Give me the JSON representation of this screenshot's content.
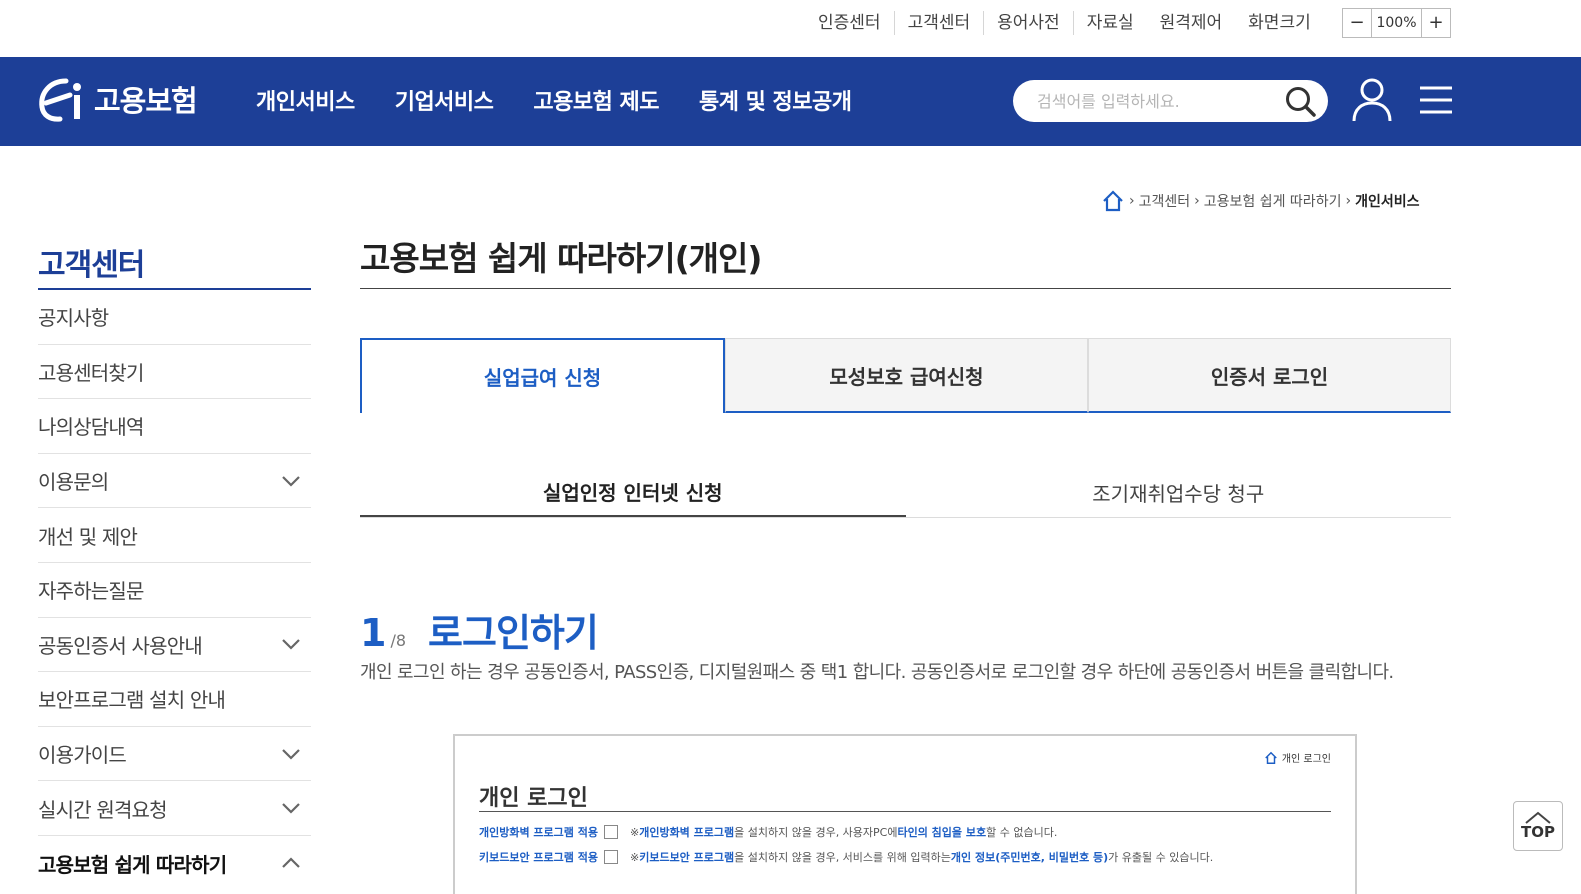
{
  "util": {
    "links": [
      "인증센터",
      "고객센터",
      "용어사전",
      "자료실",
      "원격제어",
      "화면크기"
    ],
    "zoom_minus": "−",
    "zoom_value": "100%",
    "zoom_plus": "+"
  },
  "header": {
    "logo_text": "고용보험",
    "menu": [
      "개인서비스",
      "기업서비스",
      "고용보험 제도",
      "통계 및 정보공개"
    ],
    "search_placeholder": "검색어를 입력하세요.",
    "icons": {
      "search": "search-icon",
      "user": "user-icon",
      "menu": "hamburger-icon"
    },
    "bg_color": "#1d3f97"
  },
  "breadcrumb": [
    "고객센터",
    "고용보험 쉽게 따라하기",
    "개인서비스"
  ],
  "sidebar": {
    "title": "고객센터",
    "items": [
      {
        "label": "공지사항",
        "expandable": false
      },
      {
        "label": "고용센터찾기",
        "expandable": false
      },
      {
        "label": "나의상담내역",
        "expandable": false
      },
      {
        "label": "이용문의",
        "expandable": true
      },
      {
        "label": "개선 및 제안",
        "expandable": false
      },
      {
        "label": "자주하는질문",
        "expandable": false
      },
      {
        "label": "공동인증서 사용안내",
        "expandable": true
      },
      {
        "label": "보안프로그램 설치 안내",
        "expandable": false
      },
      {
        "label": "이용가이드",
        "expandable": true
      },
      {
        "label": "실시간 원격요청",
        "expandable": true
      },
      {
        "label": "고용보험 쉽게 따라하기",
        "expandable": true,
        "expanded": true,
        "active": true
      }
    ]
  },
  "main": {
    "title": "고용보험 쉽게 따라하기(개인)",
    "tabs": [
      {
        "label": "실업급여 신청",
        "active": true
      },
      {
        "label": "모성보호 급여신청",
        "active": false
      },
      {
        "label": "인증서 로그인",
        "active": false
      }
    ],
    "subtabs": [
      {
        "label": "실업인정 인터넷 신청",
        "active": true
      },
      {
        "label": "조기재취업수당 청구",
        "active": false
      }
    ],
    "step": {
      "current": "1",
      "total": "/8",
      "title": "로그인하기",
      "description": "개인 로그인 하는 경우 공동인증서, PASS인증, 디지털원패스 중 택1 합니다. 공동인증서로 로그인할 경우 하단에 공동인증서 버튼을 클릭합니다."
    },
    "screenshot": {
      "breadcrumb": "개인 로그인",
      "title": "개인 로그인",
      "rows": [
        {
          "label": "개인방화벽 프로그램 적용",
          "note_prefix": "※ ",
          "note_hl1": "개인방화벽 프로그램",
          "note_mid": "을 설치하지 않을 경우, 사용자PC에 ",
          "note_hl2": "타인의 침입을 보호",
          "note_suffix": "할 수 없습니다."
        },
        {
          "label": "키보드보안 프로그램 적용",
          "note_prefix": "※ ",
          "note_hl1": "키보드보안 프로그램",
          "note_mid": "을 설치하지 않을 경우, 서비스를 위해 입력하는 ",
          "note_hl2": "개인 정보(주민번호, 비밀번호 등)",
          "note_suffix": "가 유출될 수 있습니다."
        }
      ]
    }
  },
  "top_button": "TOP",
  "colors": {
    "primary": "#1d3f97",
    "accent": "#1d5ec4"
  }
}
